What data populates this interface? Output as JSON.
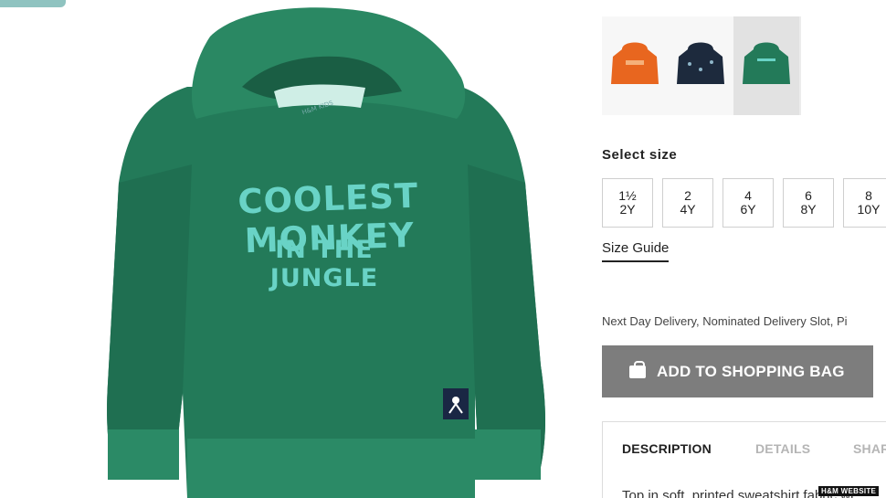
{
  "product": {
    "print_line1": "COOLEST MONKEY",
    "print_line2": "IN THE JUNGLE",
    "neck_label": "H&M KIDS"
  },
  "thumbnails": [
    {
      "color_hex": "#e8661f",
      "selected": false
    },
    {
      "color_hex": "#1d2a3d",
      "selected": false
    },
    {
      "color_hex": "#237a59",
      "selected": true
    }
  ],
  "size_selector": {
    "heading": "Select size",
    "options": [
      {
        "line1": "1½",
        "line2": "2Y"
      },
      {
        "line1": "2",
        "line2": "4Y"
      },
      {
        "line1": "4",
        "line2": "6Y"
      },
      {
        "line1": "6",
        "line2": "8Y"
      },
      {
        "line1": "8",
        "line2": "10Y"
      }
    ],
    "guide_label": "Size Guide"
  },
  "delivery_text": "Next Day Delivery, Nominated Delivery Slot, Pi",
  "add_to_bag_label": "ADD TO SHOPPING BAG",
  "tabs": {
    "description": "DESCRIPTION",
    "details": "DETAILS",
    "share": "SHAR"
  },
  "description_text": "Top in soft, printed sweatshirt fabric wi",
  "watermark": "H&M WEBSITE",
  "colors": {
    "hoodie_green": "#237a59",
    "print_mint": "#69d3c6",
    "button_grey": "#7d7d7d"
  }
}
